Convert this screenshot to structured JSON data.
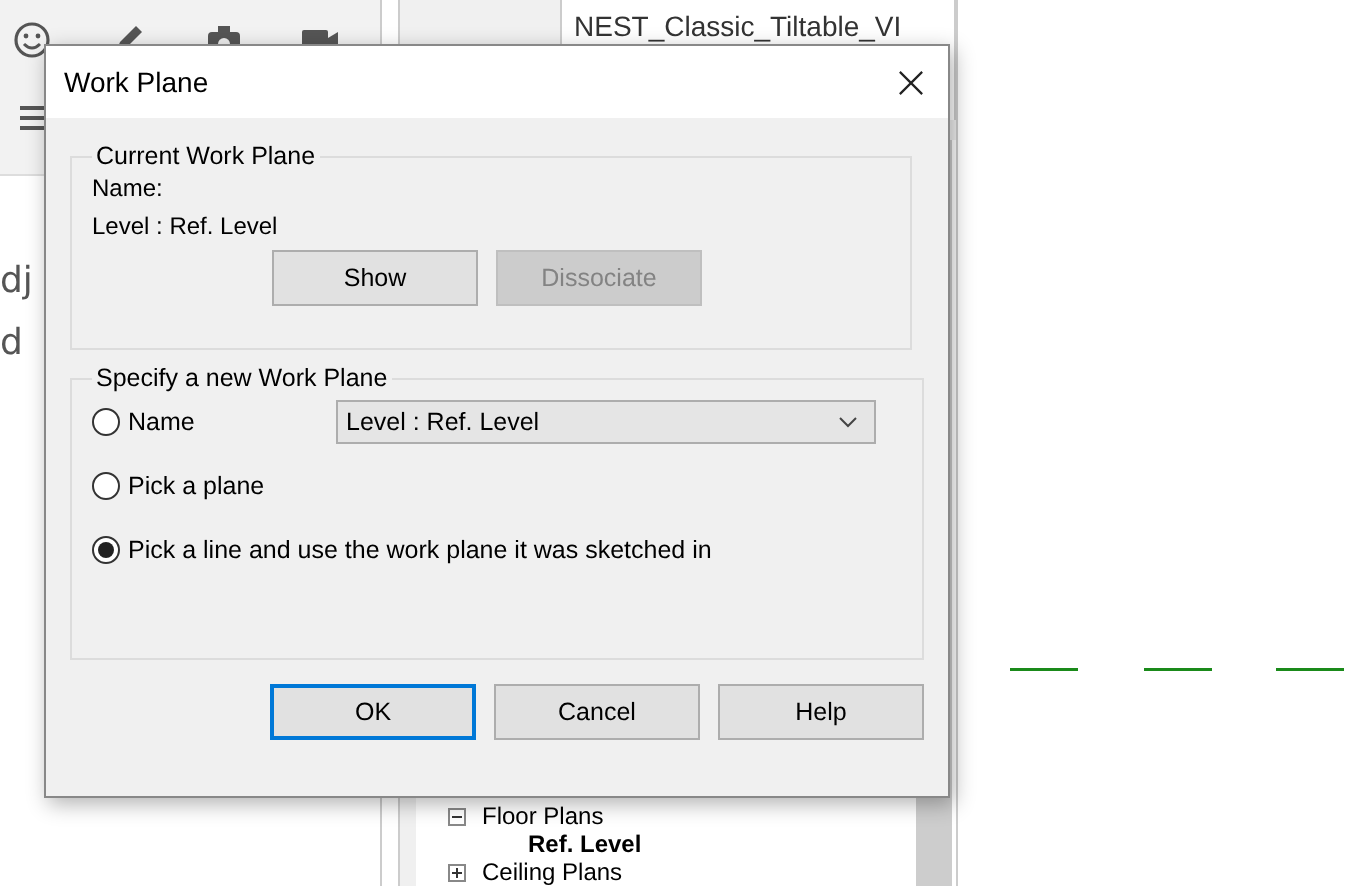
{
  "background": {
    "left_panel": {
      "texts": [
        "dj",
        "d"
      ]
    },
    "browser": {
      "header": "NEST_Classic_Tiltable_VI",
      "tree": [
        {
          "label": "Floor Plans",
          "expanded": true,
          "children": [
            {
              "label": "Ref. Level"
            }
          ]
        },
        {
          "label": "Ceiling Plans",
          "expanded": false
        }
      ]
    }
  },
  "dialog": {
    "title": "Work Plane",
    "current": {
      "legend": "Current Work Plane",
      "name_label": "Name:",
      "value": "Level : Ref. Level",
      "buttons": [
        {
          "label": "Show",
          "disabled": false
        },
        {
          "label": "Dissociate",
          "disabled": true
        }
      ]
    },
    "new": {
      "legend": "Specify a new Work Plane",
      "options": [
        {
          "kind": "dropdown",
          "label": "Name",
          "selected": false,
          "value": "Level : Ref. Level"
        },
        {
          "kind": "plain",
          "label": "Pick a plane",
          "selected": false
        },
        {
          "kind": "plain",
          "label": "Pick a line and use the work plane it was sketched in",
          "selected": true
        }
      ]
    },
    "buttons": [
      {
        "label": "OK",
        "default": true
      },
      {
        "label": "Cancel",
        "default": false
      },
      {
        "label": "Help",
        "default": false
      }
    ]
  }
}
